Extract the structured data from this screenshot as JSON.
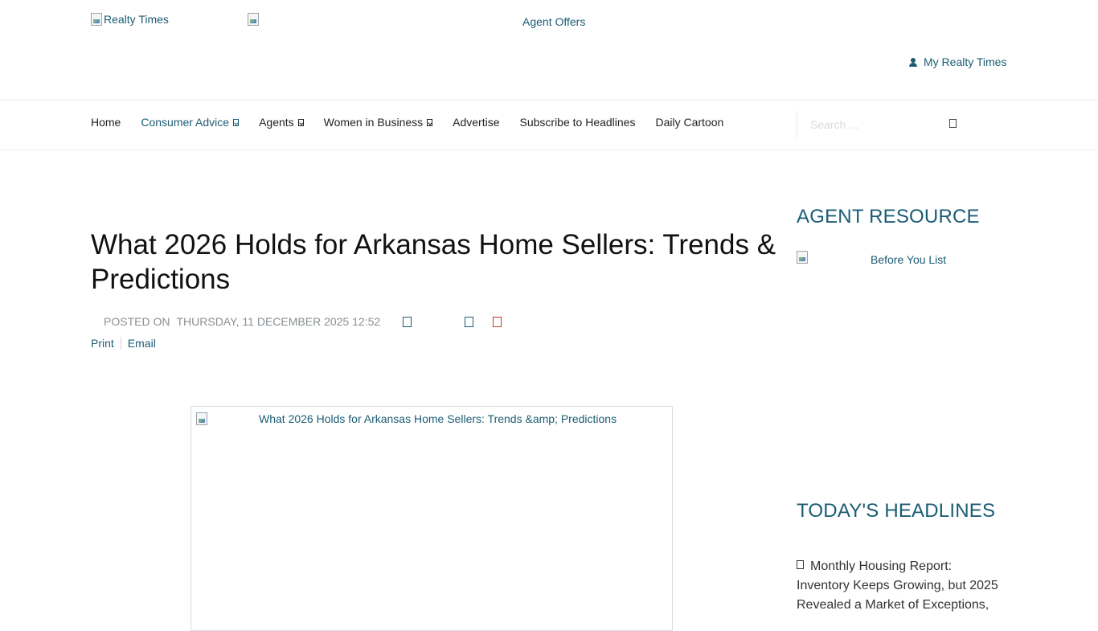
{
  "header": {
    "logo_alt": "Realty Times",
    "banner_alt": "",
    "agent_offers": "Agent Offers",
    "my_realty_times": "My Realty Times"
  },
  "nav": {
    "items": [
      {
        "label": "Home",
        "dropdown": false,
        "active": false
      },
      {
        "label": "Consumer Advice",
        "dropdown": true,
        "active": true
      },
      {
        "label": "Agents",
        "dropdown": true,
        "active": false
      },
      {
        "label": "Women in Business",
        "dropdown": true,
        "active": false
      },
      {
        "label": "Advertise",
        "dropdown": false,
        "active": false
      },
      {
        "label": "Subscribe to Headlines",
        "dropdown": false,
        "active": false
      },
      {
        "label": "Daily Cartoon",
        "dropdown": false,
        "active": false
      }
    ],
    "search_placeholder": "Search ..."
  },
  "article": {
    "title": "What 2026 Holds for Arkansas Home Sellers: Trends & Predictions",
    "posted_label": "Posted on",
    "posted_date": "Thursday, 11 December 2025 12:52",
    "print": "Print",
    "email": "Email",
    "image_alt": "What 2026 Holds for Arkansas Home Sellers: Trends &amp; Predictions"
  },
  "sidebar": {
    "agent_resource_heading": "Agent Resource",
    "before_you_list_alt": "Before You List",
    "todays_headlines_heading": "Today's Headlines",
    "headline_1": "Monthly Housing Report: Inventory Keeps Growing, but 2025 Revealed a Market of Exceptions,"
  },
  "colors": {
    "link": "#1a5c73",
    "text": "#333333",
    "muted": "#8a8f93",
    "rule": "#ececec"
  }
}
